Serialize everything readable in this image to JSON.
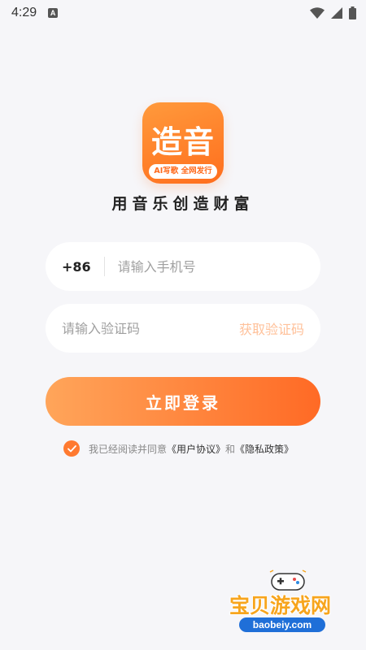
{
  "status_bar": {
    "time": "4:29",
    "notification": "A"
  },
  "app": {
    "logo_text": "造音",
    "logo_tag": "AI写歌 全网发行",
    "slogan": "用音乐创造财富"
  },
  "login_form": {
    "phone_prefix": "+86",
    "phone_placeholder": "请输入手机号",
    "code_placeholder": "请输入验证码",
    "get_code_label": "获取验证码",
    "login_label": "立即登录"
  },
  "agreement": {
    "checked": true,
    "prefix": "我已经阅读并同意",
    "user_agreement": "《用户协议》",
    "and": "和",
    "privacy_policy": "《隐私政策》"
  },
  "watermark": {
    "title": "宝贝游戏网",
    "url": "baobeiy.com"
  },
  "colors": {
    "brand": "#ff6e1d",
    "brand_light": "#ffa55a",
    "background": "#f6f6f9"
  }
}
